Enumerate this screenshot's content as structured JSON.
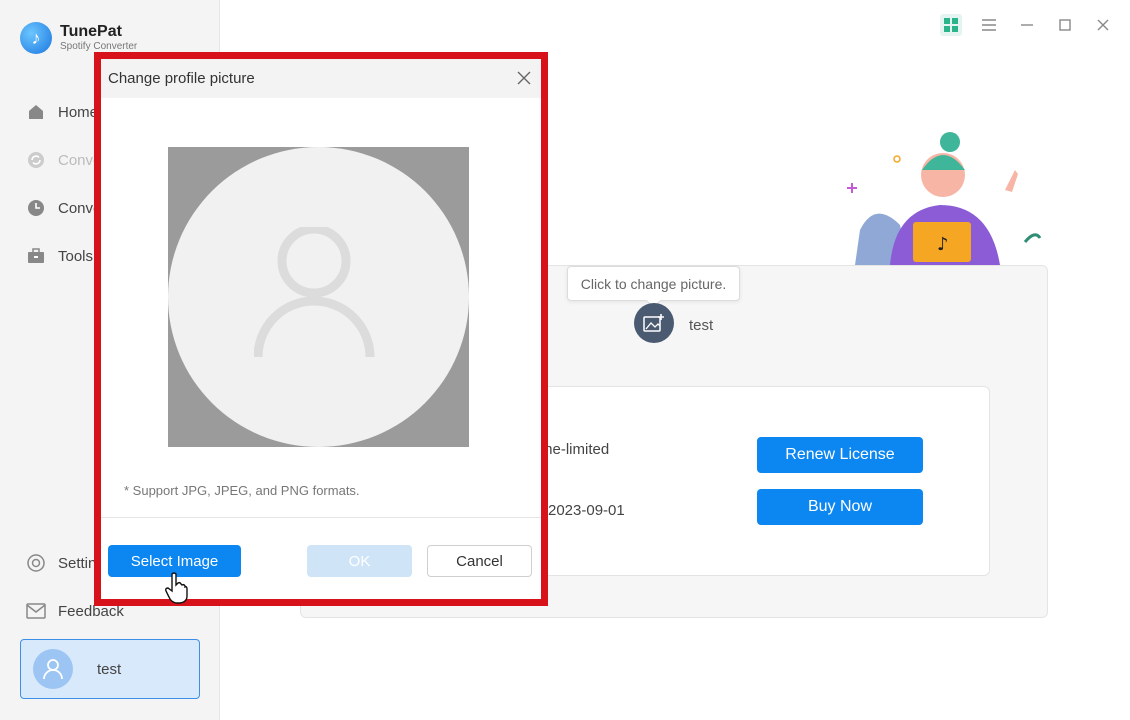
{
  "app": {
    "name": "TunePat",
    "subtitle": "Spotify Converter"
  },
  "sidebar": {
    "items": [
      {
        "label": "Home",
        "icon": "home-icon"
      },
      {
        "label": "Converting",
        "icon": "converting-icon"
      },
      {
        "label": "Converted",
        "icon": "clock-icon"
      },
      {
        "label": "Tools",
        "icon": "toolbox-icon"
      }
    ],
    "bottom": [
      {
        "label": "Settings",
        "icon": "gear-icon"
      },
      {
        "label": "Feedback",
        "icon": "mail-icon"
      }
    ],
    "user": {
      "name": "test"
    }
  },
  "main": {
    "tooltip": "Click to change picture.",
    "profile_name": "test",
    "license_type_partial": "me-limited",
    "expiry_partial": "2023-09-01",
    "renew_label": "Renew License",
    "buy_label": "Buy Now"
  },
  "modal": {
    "title": "Change profile picture",
    "support_note": "* Support JPG, JPEG, and PNG formats.",
    "select_label": "Select Image",
    "ok_label": "OK",
    "cancel_label": "Cancel"
  },
  "colors": {
    "accent": "#0c86f0",
    "highlight_frame": "#d8121a"
  }
}
